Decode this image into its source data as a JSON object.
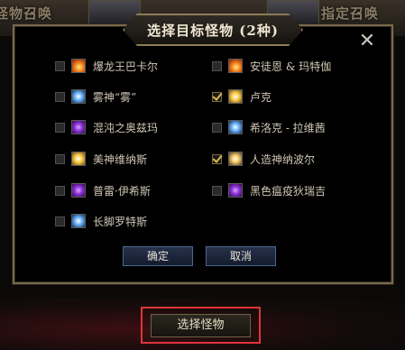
{
  "background": {
    "left_tab": "怪物召唤",
    "right_tab": "指定召唤"
  },
  "dialog": {
    "title": "选择目标怪物 (2种)",
    "close_glyph": "✕",
    "options": [
      {
        "label": "爆龙王巴卡尔",
        "icon": "fire-attribute-icon",
        "checked": false
      },
      {
        "label": "安徒恩 & 玛特伽",
        "icon": "fire-attribute-icon",
        "checked": false
      },
      {
        "label": "雾神“雾”",
        "icon": "water-attribute-icon",
        "checked": false
      },
      {
        "label": "卢克",
        "icon": "light-attribute-icon",
        "checked": true
      },
      {
        "label": "混沌之奥兹玛",
        "icon": "dark-attribute-icon",
        "checked": false
      },
      {
        "label": "希洛克 - 拉维茜",
        "icon": "water-attribute-icon",
        "checked": false
      },
      {
        "label": "美神维纳斯",
        "icon": "light-attribute-icon",
        "checked": false
      },
      {
        "label": "人造神纳波尔",
        "icon": "mixed-attribute-icon",
        "checked": true
      },
      {
        "label": "普雷·伊希斯",
        "icon": "dark-attribute-icon",
        "checked": false
      },
      {
        "label": "黑色瘟疫狄瑞吉",
        "icon": "dark-attribute-icon",
        "checked": false
      },
      {
        "label": "长脚罗特斯",
        "icon": "water-attribute-icon",
        "checked": false
      }
    ],
    "confirm_label": "确定",
    "cancel_label": "取消"
  },
  "select_button_label": "选择怪物"
}
